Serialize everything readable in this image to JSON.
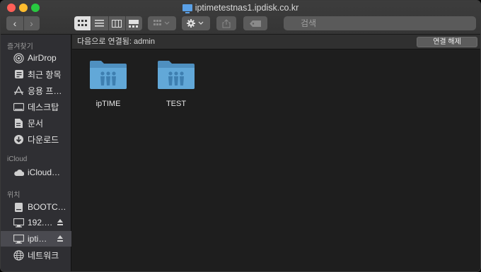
{
  "window": {
    "title": "iptimetestnas1.ipdisk.co.kr"
  },
  "toolbar": {
    "back_label": "‹",
    "forward_label": "›",
    "views": [
      "icon-view",
      "list-view",
      "column-view",
      "gallery-view"
    ],
    "search_placeholder": "검색"
  },
  "sidebar": {
    "favorites_header": "즐겨찾기",
    "favorites": [
      {
        "label": "AirDrop",
        "icon": "airdrop-icon"
      },
      {
        "label": "최근 항목",
        "icon": "recents-icon"
      },
      {
        "label": "응용 프…",
        "icon": "applications-icon"
      },
      {
        "label": "데스크탑",
        "icon": "desktop-icon"
      },
      {
        "label": "문서",
        "icon": "documents-icon"
      },
      {
        "label": "다운로드",
        "icon": "downloads-icon"
      }
    ],
    "icloud_header": "iCloud",
    "icloud": [
      {
        "label": "iCloud…",
        "icon": "icloud-icon"
      }
    ],
    "locations_header": "위치",
    "locations": [
      {
        "label": "BOOTC…",
        "icon": "disk-icon",
        "eject": false
      },
      {
        "label": "192.…",
        "icon": "monitor-icon",
        "eject": true
      },
      {
        "label": "ipti…",
        "icon": "monitor-icon",
        "eject": true,
        "selected": true
      },
      {
        "label": "네트워크",
        "icon": "network-icon",
        "eject": false
      }
    ]
  },
  "pathbar": {
    "connected_text": "다음으로 연결됨: admin",
    "disconnect_label": "연결 해제"
  },
  "folders": [
    {
      "name": "ipTIME"
    },
    {
      "name": "TEST"
    }
  ],
  "colors": {
    "folder_front": "#62a8d8",
    "folder_back": "#4f90c0",
    "accent": "#5aa0e6"
  }
}
